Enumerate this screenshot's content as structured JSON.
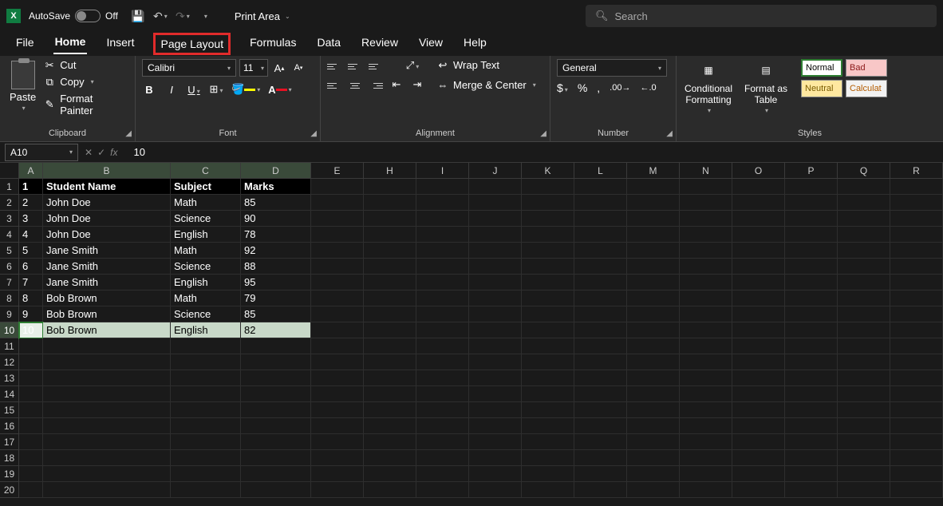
{
  "titlebar": {
    "autosave_label": "AutoSave",
    "autosave_state": "Off",
    "doc_title": "Print Area",
    "search_placeholder": "Search"
  },
  "tabs": [
    "File",
    "Home",
    "Insert",
    "Page Layout",
    "Formulas",
    "Data",
    "Review",
    "View",
    "Help"
  ],
  "active_tab": "Home",
  "highlighted_tab": "Page Layout",
  "ribbon": {
    "clipboard": {
      "paste": "Paste",
      "cut": "Cut",
      "copy": "Copy",
      "format_painter": "Format Painter",
      "group_label": "Clipboard"
    },
    "font": {
      "name": "Calibri",
      "size": "11",
      "group_label": "Font"
    },
    "alignment": {
      "wrap": "Wrap Text",
      "merge": "Merge & Center",
      "group_label": "Alignment"
    },
    "number": {
      "format": "General",
      "group_label": "Number"
    },
    "styles": {
      "conditional": "Conditional Formatting",
      "format_table": "Format as Table",
      "normal": "Normal",
      "bad": "Bad",
      "neutral": "Neutral",
      "calculation": "Calculat",
      "group_label": "Styles"
    }
  },
  "namebox": "A10",
  "formula": "10",
  "columns": [
    "A",
    "B",
    "C",
    "D",
    "E",
    "H",
    "I",
    "J",
    "K",
    "L",
    "M",
    "N",
    "O",
    "P",
    "Q",
    "R"
  ],
  "selected_cols": [
    "A",
    "B",
    "C",
    "D"
  ],
  "selected_row": 10,
  "sheet": {
    "headers": [
      "1",
      "Student Name",
      "Subject",
      "Marks"
    ],
    "rows": [
      {
        "n": "2",
        "name": "John Doe",
        "subj": "Math",
        "marks": "85"
      },
      {
        "n": "3",
        "name": "John Doe",
        "subj": "Science",
        "marks": "90"
      },
      {
        "n": "4",
        "name": "John Doe",
        "subj": "English",
        "marks": "78"
      },
      {
        "n": "5",
        "name": "Jane Smith",
        "subj": "Math",
        "marks": "92"
      },
      {
        "n": "6",
        "name": "Jane Smith",
        "subj": "Science",
        "marks": "88"
      },
      {
        "n": "7",
        "name": "Jane Smith",
        "subj": "English",
        "marks": "95"
      },
      {
        "n": "8",
        "name": "Bob Brown",
        "subj": "Math",
        "marks": "79"
      },
      {
        "n": "9",
        "name": "Bob Brown",
        "subj": "Science",
        "marks": "85"
      },
      {
        "n": "10",
        "name": "Bob Brown",
        "subj": "English",
        "marks": "82"
      }
    ]
  }
}
